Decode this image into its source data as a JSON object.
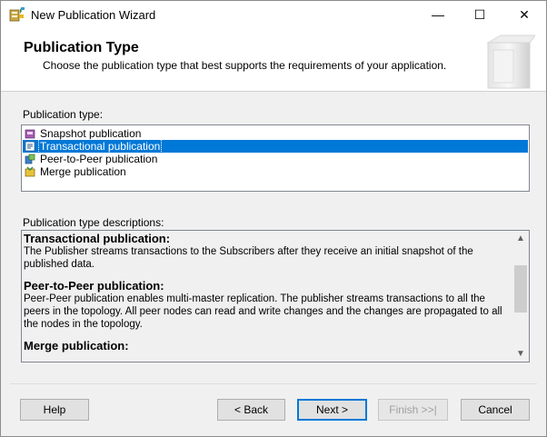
{
  "window": {
    "title": "New Publication Wizard",
    "controls": {
      "minimize": "—",
      "maximize": "☐",
      "close": "✕"
    }
  },
  "header": {
    "title": "Publication Type",
    "subtitle": "Choose the publication type that best supports the requirements of your application."
  },
  "publication_type": {
    "label": "Publication type:",
    "items": [
      {
        "label": "Snapshot publication",
        "icon": "snapshot-publication-icon",
        "selected": false
      },
      {
        "label": "Transactional publication",
        "icon": "transactional-publication-icon",
        "selected": true
      },
      {
        "label": "Peer-to-Peer publication",
        "icon": "peer-to-peer-publication-icon",
        "selected": false
      },
      {
        "label": "Merge publication",
        "icon": "merge-publication-icon",
        "selected": false
      }
    ]
  },
  "descriptions": {
    "label": "Publication type descriptions:",
    "sections": [
      {
        "heading": "Transactional publication:",
        "text": "The Publisher streams transactions to the Subscribers after they receive an initial snapshot of the published data."
      },
      {
        "heading": "Peer-to-Peer publication:",
        "text": "Peer-Peer publication enables multi-master replication. The publisher streams transactions to all the peers in the topology. All peer nodes can read and write changes and the changes are propagated to all the nodes in the topology."
      },
      {
        "heading": "Merge publication:",
        "text": ""
      }
    ]
  },
  "buttons": {
    "help": "Help",
    "back": "< Back",
    "next": "Next >",
    "finish": "Finish >>|",
    "cancel": "Cancel"
  },
  "colors": {
    "selection": "#0078d7",
    "default_button_border": "#0078d7"
  }
}
